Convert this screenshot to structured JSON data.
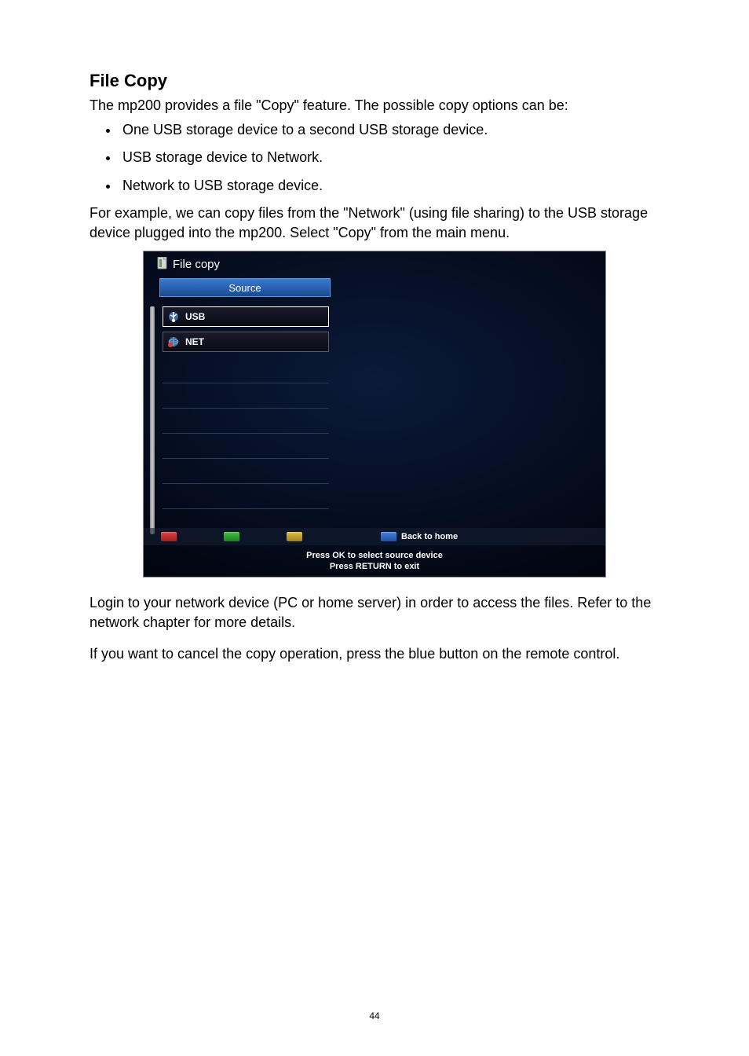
{
  "heading": "File Copy",
  "intro": "The mp200 provides a file \"Copy\" feature. The possible copy options can be:",
  "options": [
    "One USB storage device to a second USB storage device.",
    "USB storage device to Network.",
    "Network to USB storage device."
  ],
  "example": "For example, we can copy files from the \"Network\" (using file sharing) to the USB storage device plugged into the mp200. Select \"Copy\" from the main menu.",
  "screenshot": {
    "title": "File copy",
    "source_header": "Source",
    "items": [
      {
        "label": "USB",
        "icon": "usb",
        "selected": true
      },
      {
        "label": "NET",
        "icon": "net",
        "selected": false
      }
    ],
    "legend_blue": "Back to home",
    "instruction_line1": "Press OK to select source device",
    "instruction_line2": "Press RETURN to exit"
  },
  "post_login": "Login to your network device (PC or home server) in order to access the files. Refer to the network chapter for more details.",
  "post_cancel": "If you want to cancel the copy operation, press the blue button on the remote control.",
  "page_number": "44"
}
